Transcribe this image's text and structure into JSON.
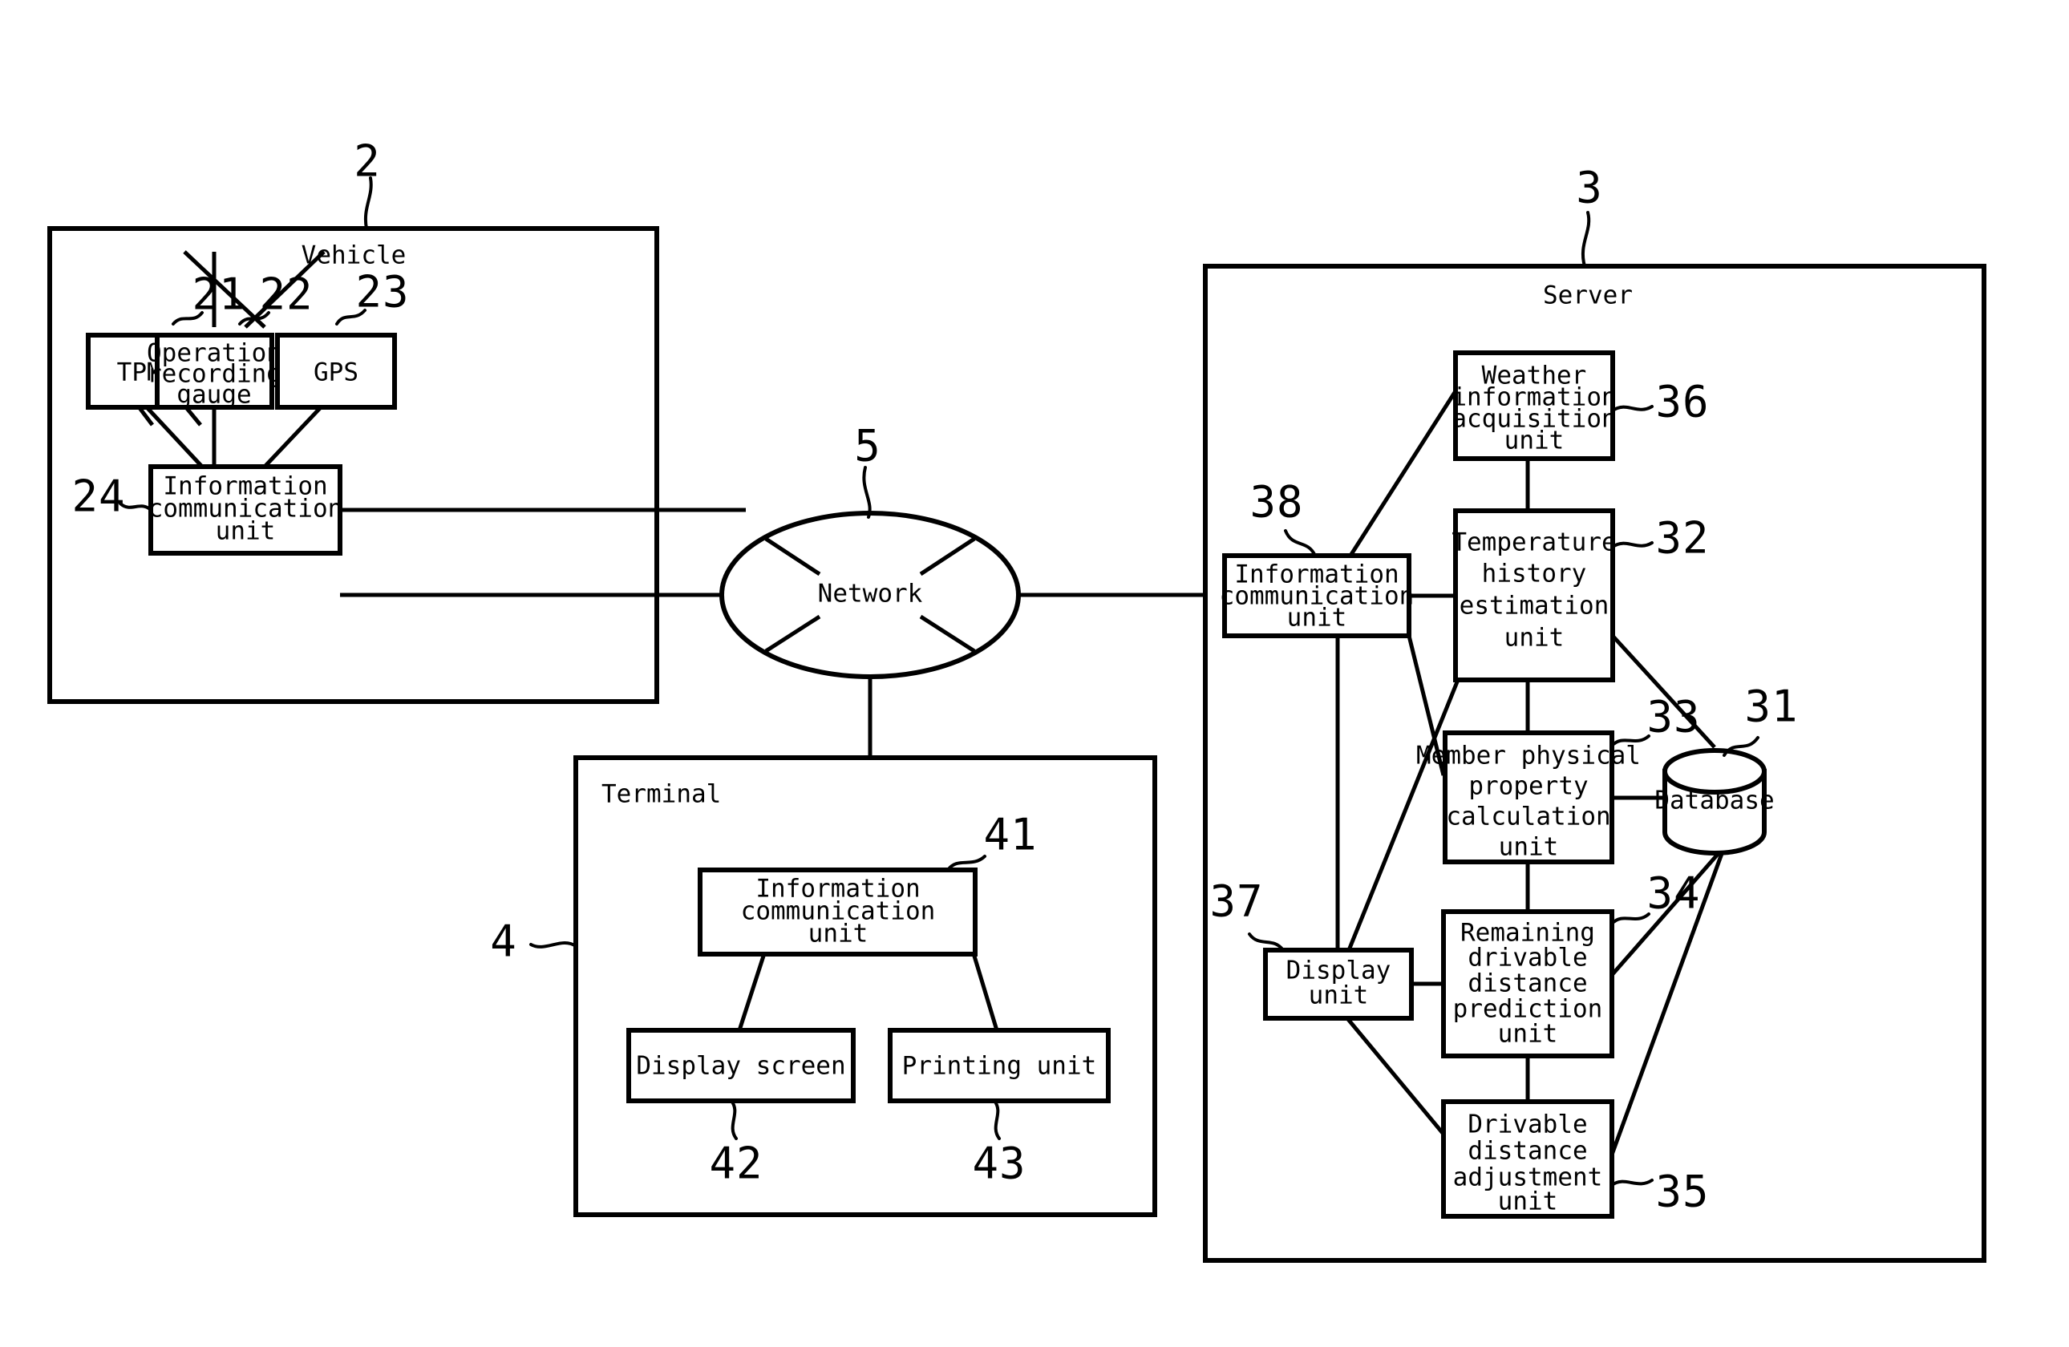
{
  "figure": {
    "kind": "patent-block-diagram",
    "background_color": "#ffffff",
    "line_color": "#000000"
  },
  "containers": {
    "vehicle": {
      "title": "Vehicle",
      "ref": "2"
    },
    "terminal": {
      "title": "Terminal",
      "ref": "4"
    },
    "server": {
      "title": "Server",
      "ref": "3"
    }
  },
  "network": {
    "label": "Network",
    "ref": "5"
  },
  "vehicle_nodes": [
    {
      "label": "TPMS",
      "ref": "21"
    },
    {
      "label": "Operation\nrecording\ngauge",
      "ref": "22"
    },
    {
      "label": "GPS",
      "ref": "23"
    },
    {
      "label": "Information\ncommunication\nunit",
      "ref": "24"
    }
  ],
  "terminal_nodes": [
    {
      "label": "Information\ncommunication\nunit",
      "ref": "41"
    },
    {
      "label": "Display screen",
      "ref": "42"
    },
    {
      "label": "Printing unit",
      "ref": "43"
    }
  ],
  "server_nodes": [
    {
      "label": "Database",
      "ref": "31"
    },
    {
      "label": "Temperature\nhistory\nestimation\nunit",
      "ref": "32"
    },
    {
      "label": "Member physical\nproperty\ncalculation\nunit",
      "ref": "33"
    },
    {
      "label": "Remaining\ndrivable\ndistance\nprediction\nunit",
      "ref": "34"
    },
    {
      "label": "Drivable\ndistance\nadjustment\nunit",
      "ref": "35"
    },
    {
      "label": "Weather\ninformation\nacquisition\nunit",
      "ref": "36"
    },
    {
      "label": "Display\nunit",
      "ref": "37"
    },
    {
      "label": "Information\ncommunication\nunit",
      "ref": "38"
    }
  ],
  "text": {
    "tpms": "TPMS",
    "gps": "GPS",
    "operation_recording_gauge_l1": "Operation",
    "operation_recording_gauge_l2": "recording",
    "operation_recording_gauge_l3": "gauge",
    "info_comm_l1": "Information",
    "info_comm_l2": "communication",
    "info_comm_l3": "unit",
    "term_info_comm_l1": "Information",
    "term_info_comm_l2": "communication",
    "term_info_comm_l3": "unit",
    "srv_info_comm_l1": "Information",
    "srv_info_comm_l2": "communication",
    "srv_info_comm_l3": "unit",
    "display_screen": "Display screen",
    "printing_unit": "Printing unit",
    "network": "Network",
    "vehicle": "Vehicle",
    "terminal": "Terminal",
    "server": "Server",
    "database": "Database",
    "weather_l1": "Weather",
    "weather_l2": "information",
    "weather_l3": "acquisition",
    "weather_l4": "unit",
    "temp_hist_l1": "Temperature",
    "temp_hist_l2": "history",
    "temp_hist_l3": "estimation",
    "temp_hist_l4": "unit",
    "member_l1": "Member physical",
    "member_l2": "property",
    "member_l3": "calculation",
    "member_l4": "unit",
    "remaining_l1": "Remaining",
    "remaining_l2": "drivable",
    "remaining_l3": "distance",
    "remaining_l4": "prediction",
    "remaining_l5": "unit",
    "drivable_l1": "Drivable",
    "drivable_l2": "distance",
    "drivable_l3": "adjustment",
    "drivable_l4": "unit",
    "display_unit_l1": "Display",
    "display_unit_l2": "unit"
  },
  "refs": {
    "r2": "2",
    "r3": "3",
    "r4": "4",
    "r5": "5",
    "r21": "21",
    "r22": "22",
    "r23": "23",
    "r24": "24",
    "r31": "31",
    "r32": "32",
    "r33": "33",
    "r34": "34",
    "r35": "35",
    "r36": "36",
    "r37": "37",
    "r38": "38",
    "r41": "41",
    "r42": "42",
    "r43": "43"
  }
}
